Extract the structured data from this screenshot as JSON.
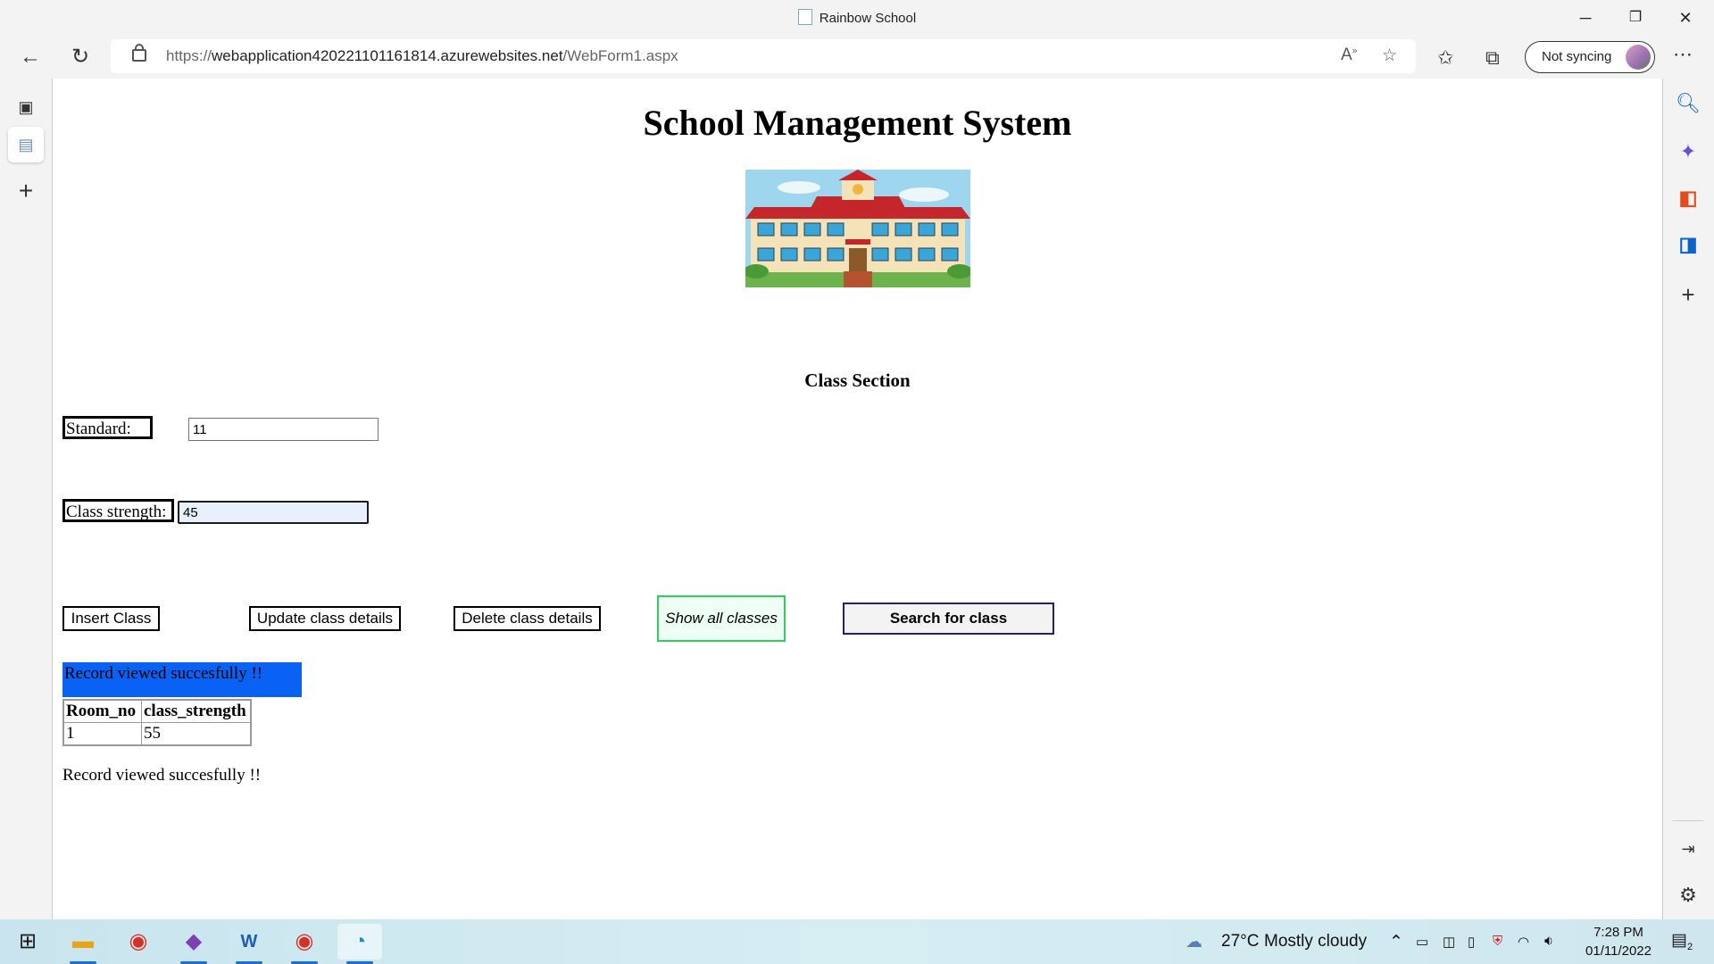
{
  "window": {
    "title": "Rainbow School",
    "minimize": "─",
    "restore": "❐",
    "close": "✕"
  },
  "toolbar": {
    "url_prefix": "https://",
    "url_host": "webapplication420221101161814.azurewebsites.net",
    "url_path": "/WebForm1.aspx",
    "sync_label": "Not syncing"
  },
  "page": {
    "heading": "School Management System",
    "section_heading": "Class Section",
    "standard_label": "Standard:",
    "standard_value": "11",
    "strength_label": "Class strength:",
    "strength_value": "45",
    "buttons": {
      "insert": "Insert Class",
      "update": "Update class details",
      "delete": "Delete class details",
      "show_all": "Show all classes",
      "search": "Search for class"
    },
    "status_message": "Record viewed succesfully !!",
    "table": {
      "headers": [
        "Room_no",
        "class_strength"
      ],
      "rows": [
        [
          "1",
          "55"
        ]
      ]
    },
    "footer_message": "Record viewed succesfully !!"
  },
  "taskbar": {
    "weather_temp": "27°C",
    "weather_desc": "Mostly cloudy",
    "time": "7:28 PM",
    "date": "01/11/2022",
    "notification_count": "2"
  },
  "icons": [
    "back-icon",
    "refresh-icon",
    "lock-icon",
    "read-aloud-icon",
    "add-favorite-icon",
    "favorites-icon",
    "collections-icon",
    "more-icon",
    "tab-actions-icon",
    "vertical-tabs-icon",
    "new-tab-icon",
    "search-icon",
    "copilot-icon",
    "office-icon",
    "outlook-icon",
    "add-icon",
    "sidebar-toggle-icon",
    "settings-icon",
    "windows-start-icon",
    "file-explorer-icon",
    "chrome-icon",
    "visual-studio-icon",
    "word-icon",
    "chrome-profile-icon",
    "edge-icon",
    "weather-icon"
  ]
}
